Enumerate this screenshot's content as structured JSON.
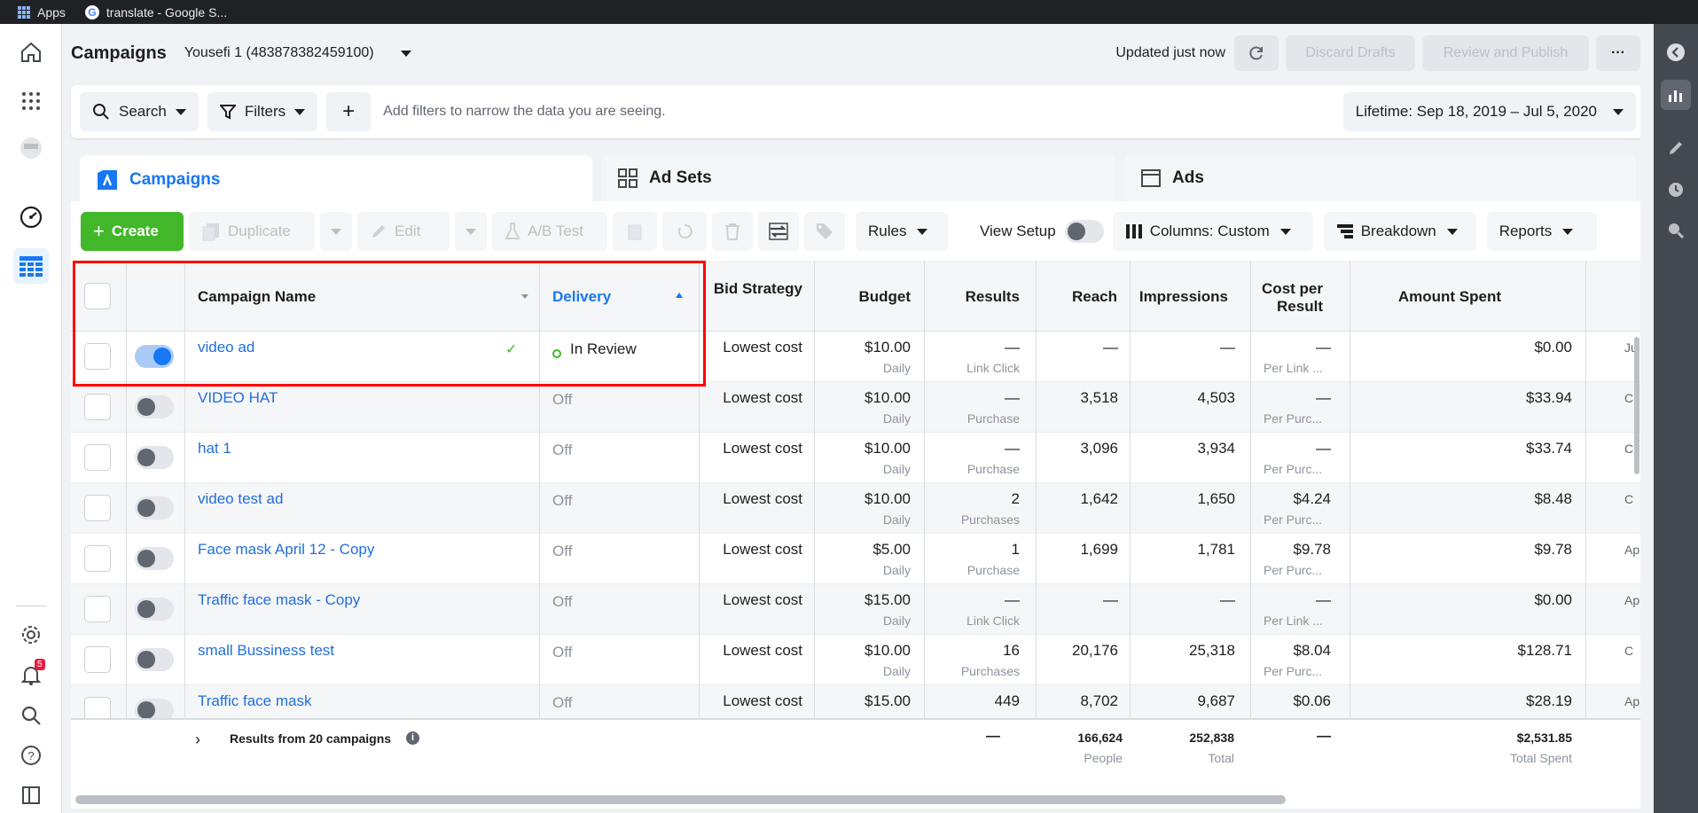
{
  "browser": {
    "bookmarks": [
      "Apps",
      "translate - Google S..."
    ]
  },
  "header": {
    "title": "Campaigns",
    "account": "Yousefi 1 (483878382459100)",
    "updated": "Updated just now",
    "discard": "Discard Drafts",
    "review": "Review and Publish",
    "more": "···"
  },
  "filters": {
    "search": "Search",
    "filters": "Filters",
    "add": "+",
    "hint": "Add filters to narrow the data you are seeing.",
    "date_range": "Lifetime: Sep 18, 2019 – Jul 5, 2020"
  },
  "tabs": [
    {
      "label": "Campaigns",
      "icon": "campaigns-icon",
      "active": true
    },
    {
      "label": "Ad Sets",
      "icon": "grid-icon",
      "active": false
    },
    {
      "label": "Ads",
      "icon": "ad-window-icon",
      "active": false
    }
  ],
  "toolbar": {
    "create": "Create",
    "duplicate": "Duplicate",
    "edit": "Edit",
    "ab_test": "A/B Test",
    "rules": "Rules",
    "view_setup": "View Setup",
    "columns": "Columns: Custom",
    "breakdown": "Breakdown",
    "reports": "Reports"
  },
  "columns": {
    "campaign_name": "Campaign Name",
    "delivery": "Delivery",
    "bid_strategy": "Bid Strategy",
    "budget": "Budget",
    "results": "Results",
    "reach": "Reach",
    "impressions": "Impressions",
    "cost_per_result": "Cost per Result",
    "amount_spent": "Amount Spent"
  },
  "rows": [
    {
      "name": "video ad",
      "on": true,
      "delivery": "In Review",
      "bid": "Lowest cost",
      "budget": "$10.00",
      "budget_type": "Daily",
      "results": "—",
      "results_type": "Link Click",
      "reach": "—",
      "impressions": "—",
      "cpr": "—",
      "cpr_type": "Per Link ...",
      "spent": "$0.00",
      "extra": "Ju"
    },
    {
      "name": "VIDEO HAT",
      "on": false,
      "delivery": "Off",
      "bid": "Lowest cost",
      "budget": "$10.00",
      "budget_type": "Daily",
      "results": "—",
      "results_type": "Purchase",
      "reach": "3,518",
      "impressions": "4,503",
      "cpr": "—",
      "cpr_type": "Per Purc...",
      "spent": "$33.94",
      "extra": "C"
    },
    {
      "name": "hat 1",
      "on": false,
      "delivery": "Off",
      "bid": "Lowest cost",
      "budget": "$10.00",
      "budget_type": "Daily",
      "results": "—",
      "results_type": "Purchase",
      "reach": "3,096",
      "impressions": "3,934",
      "cpr": "—",
      "cpr_type": "Per Purc...",
      "spent": "$33.74",
      "extra": "C"
    },
    {
      "name": "video test ad",
      "on": false,
      "delivery": "Off",
      "bid": "Lowest cost",
      "budget": "$10.00",
      "budget_type": "Daily",
      "results": "2",
      "results_type": "Purchases",
      "reach": "1,642",
      "impressions": "1,650",
      "cpr": "$4.24",
      "cpr_type": "Per Purc...",
      "spent": "$8.48",
      "extra": "C"
    },
    {
      "name": "Face mask April 12 - Copy",
      "on": false,
      "delivery": "Off",
      "bid": "Lowest cost",
      "budget": "$5.00",
      "budget_type": "Daily",
      "results": "1",
      "results_type": "Purchase",
      "reach": "1,699",
      "impressions": "1,781",
      "cpr": "$9.78",
      "cpr_type": "Per Purc...",
      "spent": "$9.78",
      "extra": "Apr"
    },
    {
      "name": "Traffic face mask - Copy",
      "on": false,
      "delivery": "Off",
      "bid": "Lowest cost",
      "budget": "$15.00",
      "budget_type": "Daily",
      "results": "—",
      "results_type": "Link Click",
      "reach": "—",
      "impressions": "—",
      "cpr": "—",
      "cpr_type": "Per Link ...",
      "spent": "$0.00",
      "extra": "Apr"
    },
    {
      "name": "small Bussiness test",
      "on": false,
      "delivery": "Off",
      "bid": "Lowest cost",
      "budget": "$10.00",
      "budget_type": "Daily",
      "results": "16",
      "results_type": "Purchases",
      "reach": "20,176",
      "impressions": "25,318",
      "cpr": "$8.04",
      "cpr_type": "Per Purc...",
      "spent": "$128.71",
      "extra": "C"
    },
    {
      "name": "Traffic face mask",
      "on": false,
      "delivery": "Off",
      "bid": "Lowest cost",
      "budget": "$15.00",
      "budget_type": "",
      "results": "449",
      "results_type": "",
      "reach": "8,702",
      "impressions": "9,687",
      "cpr": "$0.06",
      "cpr_type": "",
      "spent": "$28.19",
      "extra": "Apr"
    }
  ],
  "totals": {
    "label": "Results from 20 campaigns",
    "results": "—",
    "reach": "166,624",
    "reach_sub": "People",
    "impressions": "252,838",
    "impressions_sub": "Total",
    "cpr": "—",
    "spent": "$2,531.85",
    "spent_sub": "Total Spent"
  },
  "notifications_count": "5",
  "colors": {
    "accent": "#1877f2",
    "create": "#42b72a",
    "highlight": "#ff0000"
  }
}
